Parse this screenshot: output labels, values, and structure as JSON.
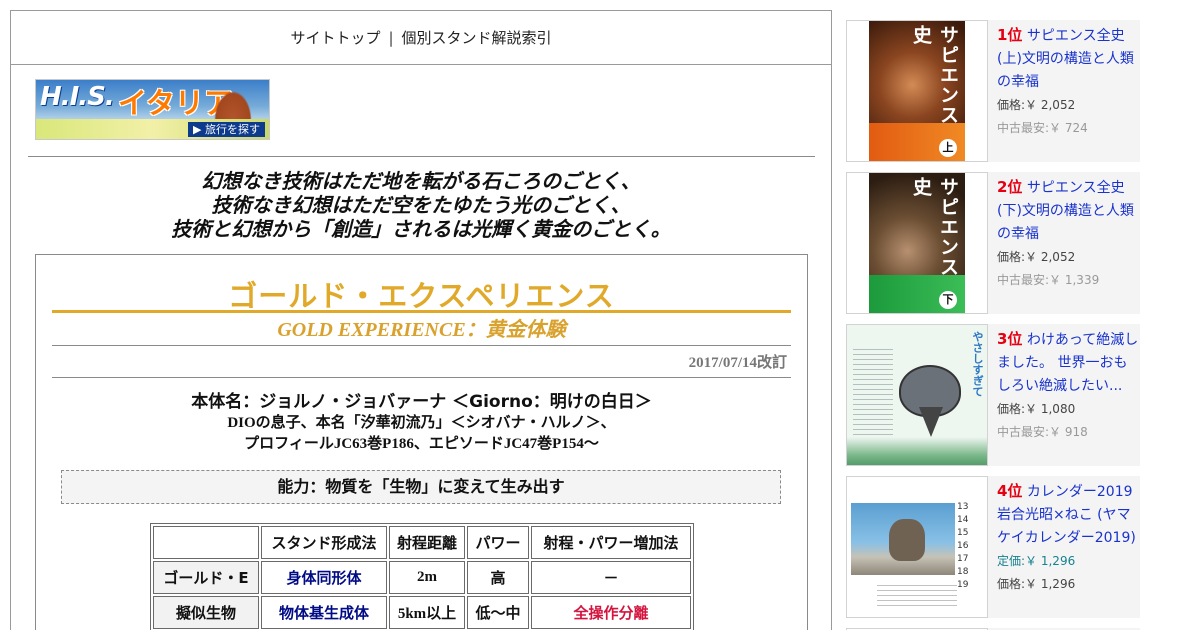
{
  "nav": {
    "site_top": "サイトトップ",
    "separator": "|",
    "stand_index": "個別スタンド解説索引"
  },
  "banner": {
    "his": "H.I.S.",
    "italy": "イタリア",
    "cta": "▶ 旅行を探す"
  },
  "motto": {
    "line1": "幻想なき技術はただ地を転がる石ころのごとく、",
    "line2": "技術なき幻想はただ空をたゆたう光のごとく、",
    "line3": "技術と幻想から「創造」されるは光輝く黄金のごとく。"
  },
  "stand": {
    "title": "ゴールド・エクスペリエンス",
    "subtitle": "GOLD EXPERIENCE：黄金体験",
    "revised": "2017/07/14改訂",
    "user_name": "本体名：ジョルノ・ジョバァーナ ＜Giorno：明けの白日＞",
    "user_desc_1": "DIOの息子、本名「汐華初流乃」＜シオバナ・ハルノ＞、",
    "user_desc_2": "プロフィールJC63巻P186、エピソードJC47巻P154～",
    "ability": "能力：物質を「生物」に変えて生み出す"
  },
  "table": {
    "headers": [
      "",
      "スタンド形成法",
      "射程距離",
      "パワー",
      "射程・パワー増加法"
    ],
    "rows": [
      [
        "ゴールド・E",
        "身体同形体",
        "2m",
        "高",
        "－"
      ],
      [
        "擬似生物",
        "物体基生成体",
        "5km以上",
        "低～中",
        "全操作分離"
      ]
    ]
  },
  "ranking": [
    {
      "rank": "1位",
      "title": "サピエンス全史(上)文明の構造と人類の幸福",
      "price": "価格:￥ 2,052",
      "used": "中古最安:￥ 724",
      "cover_title": "サピエンス全史",
      "cover_volume": "上"
    },
    {
      "rank": "2位",
      "title": "サピエンス全史(下)文明の構造と人類の幸福",
      "price": "価格:￥ 2,052",
      "used": "中古最安:￥ 1,339",
      "cover_title": "サピエンス全史",
      "cover_volume": "下"
    },
    {
      "rank": "3位",
      "title": "わけあって絶滅しました。 世界一おもしろい絶滅したい...",
      "price": "価格:￥ 1,080",
      "used": "中古最安:￥ 918",
      "cover_title": "やさしすぎて"
    },
    {
      "rank": "4位",
      "title": "カレンダー2019 岩合光昭×ねこ (ヤマケイカレンダー2019)",
      "list_price": "定価:￥ 1,296",
      "price": "価格:￥ 1,296",
      "cover_days": [
        "13",
        "14",
        "15",
        "16",
        "17",
        "18",
        "19"
      ]
    }
  ],
  "colors": {
    "gold": "#e0a92a",
    "navy": "#000b85",
    "crimson": "#d4143e",
    "rank_red": "#e50012",
    "link_blue": "#1a33cc"
  }
}
